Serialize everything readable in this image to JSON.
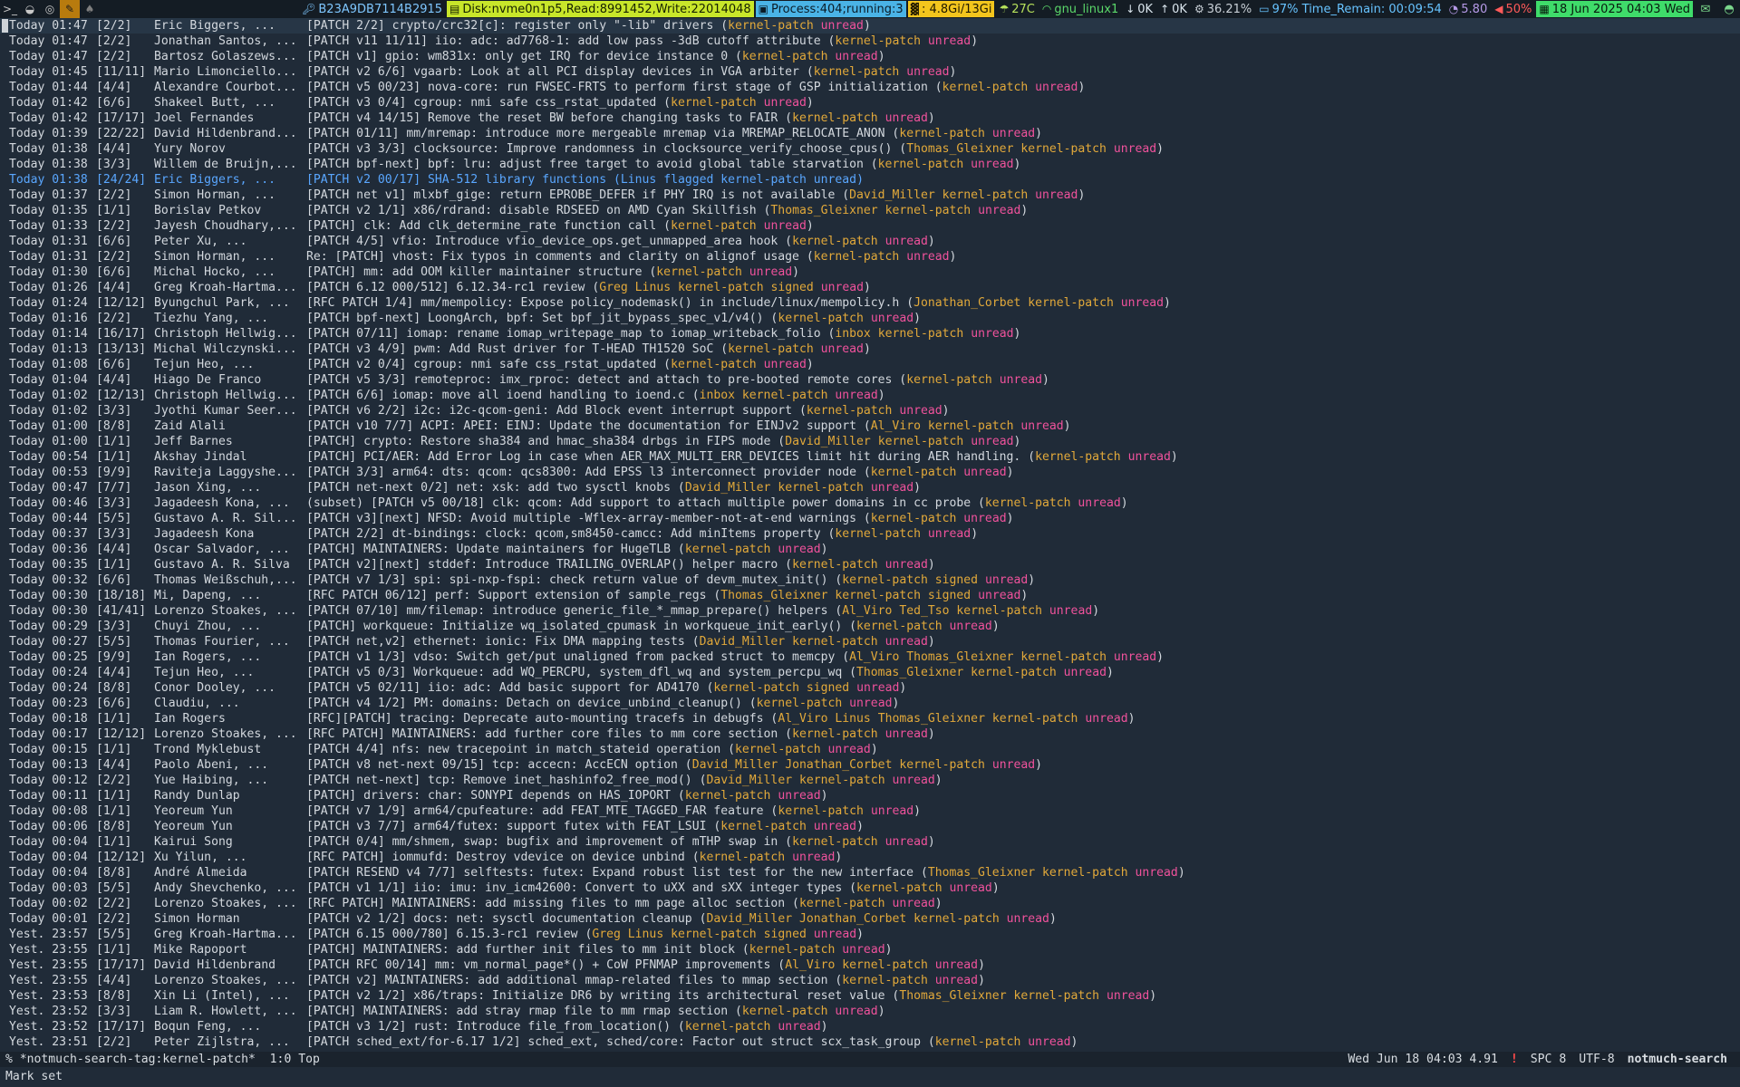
{
  "topbar": {
    "workspaces": [
      {
        "icon": ">_",
        "active": false
      },
      {
        "icon": "◒",
        "active": false
      },
      {
        "icon": "◎",
        "active": false
      },
      {
        "icon": "✎",
        "active": true
      },
      {
        "icon": "♠",
        "active": false
      }
    ],
    "segments": {
      "key": "B23A9DB7114B2915",
      "disk": "Disk:nvme0n1p5,Read:8991452,Write:22014048",
      "process": "Process:404;running:3",
      "mem": ": 4.8Gi/13Gi",
      "temp": "27C",
      "net": "gnu_linux1",
      "down": "0K",
      "up": "0K",
      "cpu": "36.21%",
      "battery": "97% Time_Remain: 00:09:54",
      "load": "5.80",
      "volume": "50%",
      "date": "18 Jun 2025 04:03 Wed"
    },
    "colors": {
      "disk": "#c8e62a",
      "process": "#4ab3e6",
      "mem": "#f3c51d",
      "date": "#3fdc6a"
    }
  },
  "threads": [
    {
      "date": "Today 01:47",
      "count": "[2/2]",
      "author": "Eric Biggers, ...",
      "subject": "[PATCH 2/2] crypto/crc32[c]: register only \"-lib\" drivers",
      "tags": [
        "kernel-patch",
        "unread"
      ],
      "cursor": true
    },
    {
      "date": "Today 01:47",
      "count": "[2/2]",
      "author": "Jonathan Santos, ...",
      "subject": "[PATCH v11 11/11] iio: adc: ad7768-1: add low pass -3dB cutoff attribute",
      "tags": [
        "kernel-patch",
        "unread"
      ]
    },
    {
      "date": "Today 01:47",
      "count": "[2/2]",
      "author": "Bartosz Golaszews...",
      "subject": "[PATCH v1] gpio: wm831x: only get IRQ for device instance 0",
      "tags": [
        "kernel-patch",
        "unread"
      ]
    },
    {
      "date": "Today 01:45",
      "count": "[11/11]",
      "author": "Mario Limonciello...",
      "subject": "[PATCH v2 6/6] vgaarb: Look at all PCI display devices in VGA arbiter",
      "tags": [
        "kernel-patch",
        "unread"
      ]
    },
    {
      "date": "Today 01:44",
      "count": "[4/4]",
      "author": "Alexandre Courbot...",
      "subject": "[PATCH v5 00/23] nova-core: run FWSEC-FRTS to perform first stage of GSP initialization",
      "tags": [
        "kernel-patch",
        "unread"
      ]
    },
    {
      "date": "Today 01:42",
      "count": "[6/6]",
      "author": "Shakeel Butt, ...",
      "subject": "[PATCH v3 0/4] cgroup: nmi safe css_rstat_updated",
      "tags": [
        "kernel-patch",
        "unread"
      ]
    },
    {
      "date": "Today 01:42",
      "count": "[17/17]",
      "author": "Joel Fernandes",
      "subject": "[PATCH v4 14/15] Remove the reset BW before changing tasks to FAIR",
      "tags": [
        "kernel-patch",
        "unread"
      ]
    },
    {
      "date": "Today 01:39",
      "count": "[22/22]",
      "author": "David Hildenbrand...",
      "subject": "[PATCH 01/11] mm/mremap: introduce more mergeable mremap via MREMAP_RELOCATE_ANON",
      "tags": [
        "kernel-patch",
        "unread"
      ]
    },
    {
      "date": "Today 01:38",
      "count": "[4/4]",
      "author": "Yury Norov",
      "subject": "[PATCH v3 3/3] clocksource: Improve randomness in clocksource_verify_choose_cpus()",
      "tags": [
        "Thomas_Gleixner",
        "kernel-patch",
        "unread"
      ]
    },
    {
      "date": "Today 01:38",
      "count": "[3/3]",
      "author": "Willem de Bruijn,...",
      "subject": "[PATCH bpf-next] bpf: lru: adjust free target to avoid global table starvation",
      "tags": [
        "kernel-patch",
        "unread"
      ]
    },
    {
      "date": "Today 01:38",
      "count": "[24/24]",
      "author": "Eric Biggers, ...",
      "subject": "[PATCH v2 00/17] SHA-512 library functions",
      "tags": [
        "Linus",
        "flagged",
        "kernel-patch",
        "unread"
      ],
      "flagged": true
    },
    {
      "date": "Today 01:37",
      "count": "[2/2]",
      "author": "Simon Horman, ...",
      "subject": "[PATCH net v1] mlxbf_gige: return EPROBE_DEFER if PHY IRQ is not available",
      "tags": [
        "David_Miller",
        "kernel-patch",
        "unread"
      ]
    },
    {
      "date": "Today 01:35",
      "count": "[1/1]",
      "author": "Borislav Petkov",
      "subject": "[PATCH v2 1/1] x86/rdrand: disable RDSEED on AMD Cyan Skillfish",
      "tags": [
        "Thomas_Gleixner",
        "kernel-patch",
        "unread"
      ]
    },
    {
      "date": "Today 01:33",
      "count": "[2/2]",
      "author": "Jayesh Choudhary,...",
      "subject": "[PATCH] clk: Add clk_determine_rate function call",
      "tags": [
        "kernel-patch",
        "unread"
      ]
    },
    {
      "date": "Today 01:31",
      "count": "[6/6]",
      "author": "Peter Xu, ...",
      "subject": "[PATCH 4/5] vfio: Introduce vfio_device_ops.get_unmapped_area hook",
      "tags": [
        "kernel-patch",
        "unread"
      ]
    },
    {
      "date": "Today 01:31",
      "count": "[2/2]",
      "author": "Simon Horman, ...",
      "subject": "Re: [PATCH] vhost: Fix typos in comments and clarity on alignof usage",
      "tags": [
        "kernel-patch",
        "unread"
      ]
    },
    {
      "date": "Today 01:30",
      "count": "[6/6]",
      "author": "Michal Hocko, ...",
      "subject": "[PATCH] mm: add OOM killer maintainer structure",
      "tags": [
        "kernel-patch",
        "unread"
      ]
    },
    {
      "date": "Today 01:26",
      "count": "[4/4]",
      "author": "Greg Kroah-Hartma...",
      "subject": "[PATCH 6.12 000/512] 6.12.34-rc1 review",
      "tags": [
        "Greg",
        "Linus",
        "kernel-patch",
        "signed",
        "unread"
      ]
    },
    {
      "date": "Today 01:24",
      "count": "[12/12]",
      "author": "Byungchul Park, ...",
      "subject": "[RFC PATCH 1/4] mm/mempolicy: Expose policy_nodemask() in include/linux/mempolicy.h",
      "tags": [
        "Jonathan_Corbet",
        "kernel-patch",
        "unread"
      ]
    },
    {
      "date": "Today 01:16",
      "count": "[2/2]",
      "author": "Tiezhu Yang, ...",
      "subject": "[PATCH bpf-next] LoongArch, bpf: Set bpf_jit_bypass_spec_v1/v4()",
      "tags": [
        "kernel-patch",
        "unread"
      ]
    },
    {
      "date": "Today 01:14",
      "count": "[16/17]",
      "author": "Christoph Hellwig...",
      "subject": "[PATCH 07/11] iomap: rename iomap_writepage_map to iomap_writeback_folio",
      "tags": [
        "inbox",
        "kernel-patch",
        "unread"
      ]
    },
    {
      "date": "Today 01:13",
      "count": "[13/13]",
      "author": "Michal Wilczynski...",
      "subject": "[PATCH v3 4/9] pwm: Add Rust driver for T-HEAD TH1520 SoC",
      "tags": [
        "kernel-patch",
        "unread"
      ]
    },
    {
      "date": "Today 01:08",
      "count": "[6/6]",
      "author": "Tejun Heo, ...",
      "subject": "[PATCH v2 0/4] cgroup: nmi safe css_rstat_updated",
      "tags": [
        "kernel-patch",
        "unread"
      ]
    },
    {
      "date": "Today 01:04",
      "count": "[4/4]",
      "author": "Hiago De Franco",
      "subject": "[PATCH v5 3/3] remoteproc: imx_rproc: detect and attach to pre-booted remote cores",
      "tags": [
        "kernel-patch",
        "unread"
      ]
    },
    {
      "date": "Today 01:02",
      "count": "[12/13]",
      "author": "Christoph Hellwig...",
      "subject": "[PATCH 6/6] iomap: move all ioend handling to ioend.c",
      "tags": [
        "inbox",
        "kernel-patch",
        "unread"
      ]
    },
    {
      "date": "Today 01:02",
      "count": "[3/3]",
      "author": "Jyothi Kumar Seer...",
      "subject": "[PATCH v6 2/2] i2c: i2c-qcom-geni: Add Block event interrupt support",
      "tags": [
        "kernel-patch",
        "unread"
      ]
    },
    {
      "date": "Today 01:00",
      "count": "[8/8]",
      "author": "Zaid Alali",
      "subject": "[PATCH v10 7/7] ACPI: APEI: EINJ: Update the documentation for EINJv2 support",
      "tags": [
        "Al_Viro",
        "kernel-patch",
        "unread"
      ]
    },
    {
      "date": "Today 01:00",
      "count": "[1/1]",
      "author": "Jeff Barnes",
      "subject": "[PATCH] crypto: Restore sha384 and hmac_sha384 drbgs in FIPS mode",
      "tags": [
        "David_Miller",
        "kernel-patch",
        "unread"
      ]
    },
    {
      "date": "Today 00:54",
      "count": "[1/1]",
      "author": "Akshay Jindal",
      "subject": "[PATCH] PCI/AER: Add Error Log in case when AER_MAX_MULTI_ERR_DEVICES limit hit during AER handling.",
      "tags": [
        "kernel-patch",
        "unread"
      ]
    },
    {
      "date": "Today 00:53",
      "count": "[9/9]",
      "author": "Raviteja Laggyshe...",
      "subject": "[PATCH 3/3] arm64: dts: qcom: qcs8300: Add EPSS l3 interconnect provider node",
      "tags": [
        "kernel-patch",
        "unread"
      ]
    },
    {
      "date": "Today 00:47",
      "count": "[7/7]",
      "author": "Jason Xing, ...",
      "subject": "[PATCH net-next 0/2] net: xsk: add two sysctl knobs",
      "tags": [
        "David_Miller",
        "kernel-patch",
        "unread"
      ]
    },
    {
      "date": "Today 00:46",
      "count": "[3/3]",
      "author": "Jagadeesh Kona, ...",
      "subject": "(subset) [PATCH v5 00/18] clk: qcom: Add support to attach multiple power domains in cc probe",
      "tags": [
        "kernel-patch",
        "unread"
      ]
    },
    {
      "date": "Today 00:44",
      "count": "[5/5]",
      "author": "Gustavo A. R. Sil...",
      "subject": "[PATCH v3][next] NFSD: Avoid multiple -Wflex-array-member-not-at-end warnings",
      "tags": [
        "kernel-patch",
        "unread"
      ]
    },
    {
      "date": "Today 00:37",
      "count": "[3/3]",
      "author": "Jagadeesh Kona",
      "subject": "[PATCH 2/2] dt-bindings: clock: qcom,sm8450-camcc: Add minItems property",
      "tags": [
        "kernel-patch",
        "unread"
      ]
    },
    {
      "date": "Today 00:36",
      "count": "[4/4]",
      "author": "Oscar Salvador, ...",
      "subject": "[PATCH] MAINTAINERS: Update maintainers for HugeTLB",
      "tags": [
        "kernel-patch",
        "unread"
      ]
    },
    {
      "date": "Today 00:35",
      "count": "[1/1]",
      "author": "Gustavo A. R. Silva",
      "subject": "[PATCH v2][next] stddef: Introduce TRAILING_OVERLAP() helper macro",
      "tags": [
        "kernel-patch",
        "unread"
      ]
    },
    {
      "date": "Today 00:32",
      "count": "[6/6]",
      "author": "Thomas Weißschuh,...",
      "subject": "[PATCH v7 1/3] spi: spi-nxp-fspi: check return value of devm_mutex_init()",
      "tags": [
        "kernel-patch",
        "signed",
        "unread"
      ]
    },
    {
      "date": "Today 00:30",
      "count": "[18/18]",
      "author": "Mi, Dapeng, ...",
      "subject": "[RFC PATCH 06/12] perf: Support extension of sample_regs",
      "tags": [
        "Thomas_Gleixner",
        "kernel-patch",
        "signed",
        "unread"
      ]
    },
    {
      "date": "Today 00:30",
      "count": "[41/41]",
      "author": "Lorenzo Stoakes, ...",
      "subject": "[PATCH 07/10] mm/filemap: introduce generic_file_*_mmap_prepare() helpers",
      "tags": [
        "Al_Viro",
        "Ted_Tso",
        "kernel-patch",
        "unread"
      ]
    },
    {
      "date": "Today 00:29",
      "count": "[3/3]",
      "author": "Chuyi Zhou, ...",
      "subject": "[PATCH] workqueue: Initialize wq_isolated_cpumask in workqueue_init_early()",
      "tags": [
        "kernel-patch",
        "unread"
      ]
    },
    {
      "date": "Today 00:27",
      "count": "[5/5]",
      "author": "Thomas Fourier, ...",
      "subject": "[PATCH net,v2] ethernet: ionic: Fix DMA mapping tests",
      "tags": [
        "David_Miller",
        "kernel-patch",
        "unread"
      ]
    },
    {
      "date": "Today 00:25",
      "count": "[9/9]",
      "author": "Ian Rogers, ...",
      "subject": "[PATCH v1 1/3] vdso: Switch get/put unaligned from packed struct to memcpy",
      "tags": [
        "Al_Viro",
        "Thomas_Gleixner",
        "kernel-patch",
        "unread"
      ]
    },
    {
      "date": "Today 00:24",
      "count": "[4/4]",
      "author": "Tejun Heo, ...",
      "subject": "[PATCH v5 0/3] Workqueue: add WQ_PERCPU, system_dfl_wq and system_percpu_wq",
      "tags": [
        "Thomas_Gleixner",
        "kernel-patch",
        "unread"
      ]
    },
    {
      "date": "Today 00:24",
      "count": "[8/8]",
      "author": "Conor Dooley, ...",
      "subject": "[PATCH v5 02/11] iio: adc: Add basic support for AD4170",
      "tags": [
        "kernel-patch",
        "signed",
        "unread"
      ]
    },
    {
      "date": "Today 00:23",
      "count": "[6/6]",
      "author": "Claudiu, ...",
      "subject": "[PATCH v4 1/2] PM: domains: Detach on device_unbind_cleanup()",
      "tags": [
        "kernel-patch",
        "unread"
      ]
    },
    {
      "date": "Today 00:18",
      "count": "[1/1]",
      "author": "Ian Rogers",
      "subject": "[RFC][PATCH] tracing: Deprecate auto-mounting tracefs in debugfs",
      "tags": [
        "Al_Viro",
        "Linus",
        "Thomas_Gleixner",
        "kernel-patch",
        "unread"
      ]
    },
    {
      "date": "Today 00:17",
      "count": "[12/12]",
      "author": "Lorenzo Stoakes, ...",
      "subject": "[RFC PATCH] MAINTAINERS: add further core files to mm core section",
      "tags": [
        "kernel-patch",
        "unread"
      ]
    },
    {
      "date": "Today 00:15",
      "count": "[1/1]",
      "author": "Trond Myklebust",
      "subject": "[PATCH 4/4] nfs: new tracepoint in match_stateid operation",
      "tags": [
        "kernel-patch",
        "unread"
      ]
    },
    {
      "date": "Today 00:13",
      "count": "[4/4]",
      "author": "Paolo Abeni, ...",
      "subject": "[PATCH v8 net-next 09/15] tcp: accecn: AccECN option",
      "tags": [
        "David_Miller",
        "Jonathan_Corbet",
        "kernel-patch",
        "unread"
      ]
    },
    {
      "date": "Today 00:12",
      "count": "[2/2]",
      "author": "Yue Haibing, ...",
      "subject": "[PATCH net-next] tcp: Remove inet_hashinfo2_free_mod()",
      "tags": [
        "David_Miller",
        "kernel-patch",
        "unread"
      ]
    },
    {
      "date": "Today 00:11",
      "count": "[1/1]",
      "author": "Randy Dunlap",
      "subject": "[PATCH] drivers: char: SONYPI depends on HAS_IOPORT",
      "tags": [
        "kernel-patch",
        "unread"
      ]
    },
    {
      "date": "Today 00:08",
      "count": "[1/1]",
      "author": "Yeoreum Yun",
      "subject": "[PATCH v7 1/9] arm64/cpufeature: add FEAT_MTE_TAGGED_FAR feature",
      "tags": [
        "kernel-patch",
        "unread"
      ]
    },
    {
      "date": "Today 00:06",
      "count": "[8/8]",
      "author": "Yeoreum Yun",
      "subject": "[PATCH v3 7/7] arm64/futex: support futex with FEAT_LSUI",
      "tags": [
        "kernel-patch",
        "unread"
      ]
    },
    {
      "date": "Today 00:04",
      "count": "[1/1]",
      "author": "Kairui Song",
      "subject": "[PATCH 0/4] mm/shmem, swap: bugfix and improvement of mTHP swap in",
      "tags": [
        "kernel-patch",
        "unread"
      ]
    },
    {
      "date": "Today 00:04",
      "count": "[12/12]",
      "author": "Xu Yilun, ...",
      "subject": "[RFC PATCH] iommufd: Destroy vdevice on device unbind",
      "tags": [
        "kernel-patch",
        "unread"
      ]
    },
    {
      "date": "Today 00:04",
      "count": "[8/8]",
      "author": "André Almeida",
      "subject": "[PATCH RESEND v4 7/7] selftests: futex: Expand robust list test for the new interface",
      "tags": [
        "Thomas_Gleixner",
        "kernel-patch",
        "unread"
      ]
    },
    {
      "date": "Today 00:03",
      "count": "[5/5]",
      "author": "Andy Shevchenko, ...",
      "subject": "[PATCH v1 1/1] iio: imu: inv_icm42600: Convert to uXX and sXX integer types",
      "tags": [
        "kernel-patch",
        "unread"
      ]
    },
    {
      "date": "Today 00:02",
      "count": "[2/2]",
      "author": "Lorenzo Stoakes, ...",
      "subject": "[RFC PATCH] MAINTAINERS: add missing files to mm page alloc section",
      "tags": [
        "kernel-patch",
        "unread"
      ]
    },
    {
      "date": "Today 00:01",
      "count": "[2/2]",
      "author": "Simon Horman",
      "subject": "[PATCH v2 1/2] docs: net: sysctl documentation cleanup",
      "tags": [
        "David_Miller",
        "Jonathan_Corbet",
        "kernel-patch",
        "unread"
      ]
    },
    {
      "date": "Yest. 23:57",
      "count": "[5/5]",
      "author": "Greg Kroah-Hartma...",
      "subject": "[PATCH 6.15 000/780] 6.15.3-rc1 review",
      "tags": [
        "Greg",
        "Linus",
        "kernel-patch",
        "signed",
        "unread"
      ]
    },
    {
      "date": "Yest. 23:55",
      "count": "[1/1]",
      "author": "Mike Rapoport",
      "subject": "[PATCH] MAINTAINERS: add further init files to mm init block",
      "tags": [
        "kernel-patch",
        "unread"
      ]
    },
    {
      "date": "Yest. 23:55",
      "count": "[17/17]",
      "author": "David Hildenbrand",
      "subject": "[PATCH RFC 00/14] mm: vm_normal_page*() + CoW PFNMAP improvements",
      "tags": [
        "Al_Viro",
        "kernel-patch",
        "unread"
      ]
    },
    {
      "date": "Yest. 23:55",
      "count": "[4/4]",
      "author": "Lorenzo Stoakes, ...",
      "subject": "[PATCH v2] MAINTAINERS: add additional mmap-related files to mmap section",
      "tags": [
        "kernel-patch",
        "unread"
      ]
    },
    {
      "date": "Yest. 23:53",
      "count": "[8/8]",
      "author": "Xin Li (Intel), ...",
      "subject": "[PATCH v2 1/2] x86/traps: Initialize DR6 by writing its architectural reset value",
      "tags": [
        "Thomas_Gleixner",
        "kernel-patch",
        "unread"
      ]
    },
    {
      "date": "Yest. 23:52",
      "count": "[3/3]",
      "author": "Liam R. Howlett, ...",
      "subject": "[PATCH] MAINTAINERS: add stray rmap file to mm rmap section",
      "tags": [
        "kernel-patch",
        "unread"
      ]
    },
    {
      "date": "Yest. 23:52",
      "count": "[17/17]",
      "author": "Boqun Feng, ...",
      "subject": "[PATCH v3 1/2] rust: Introduce file_from_location()",
      "tags": [
        "kernel-patch",
        "unread"
      ]
    },
    {
      "date": "Yest. 23:51",
      "count": "[2/2]",
      "author": "Peter Zijlstra, ...",
      "subject": "[PATCH sched_ext/for-6.17 1/2] sched_ext, sched/core: Factor out struct scx_task_group",
      "tags": [
        "kernel-patch",
        "unread"
      ]
    }
  ],
  "modeline": {
    "left": "% *notmuch-search-tag:kernel-patch*  1:0 Top",
    "time": "Wed Jun 18 04:03 4.91",
    "warn": "!",
    "indent": "SPC 8",
    "encoding": "UTF-8",
    "mode": "notmuch-search"
  },
  "echo": "Mark set",
  "tag_colors": {
    "kernel-patch": "#e2a93a",
    "unread": "#f0529c",
    "flagged": "#5aa7ff"
  }
}
